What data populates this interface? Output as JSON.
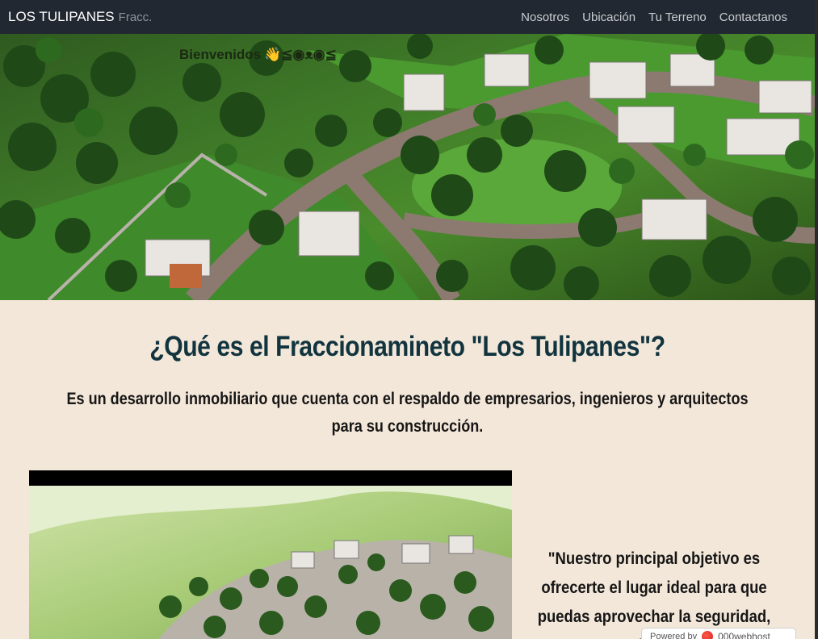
{
  "navbar": {
    "brand": "LOS TULIPANES",
    "brand_sub": "Fracc.",
    "links": [
      "Nosotros",
      "Ubicación",
      "Tu Terreno",
      "Contactanos"
    ]
  },
  "hero": {
    "welcome_text": "Bienvenidos",
    "welcome_emoji": "👋≦◉ᴥ◉≦"
  },
  "main": {
    "heading": "¿Qué es el Fraccionamineto \"Los Tulipanes\"?",
    "description": "Es un desarrollo inmobiliario que cuenta con el respaldo de empresarios, ingenieros y arquitectos para su construcción.",
    "quote": "\"Nuestro principal objetivo es ofrecerte el lugar ideal para que puedas aprovechar la seguridad, tranquilidad de la"
  },
  "badge": {
    "powered_label": "Powered by",
    "host_name": "000webhost"
  },
  "colors": {
    "navbar_bg": "#222831",
    "page_bg": "#f3e7d9",
    "heading": "#11343f"
  }
}
